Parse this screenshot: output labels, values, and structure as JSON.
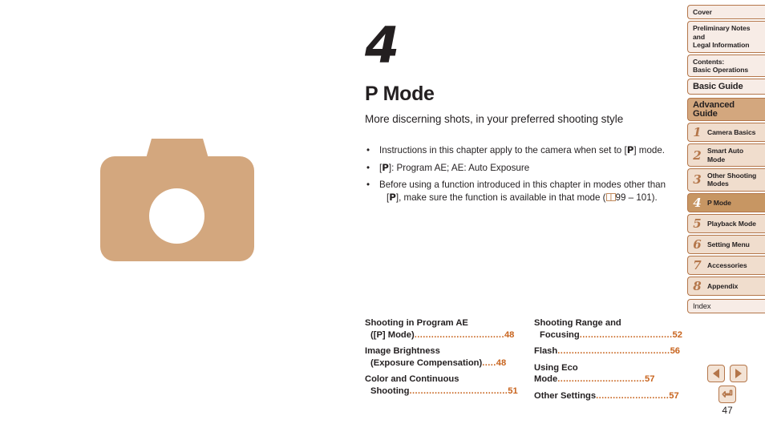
{
  "document": {
    "page_number": "47"
  },
  "illustration": {
    "name": "camera-illustration",
    "color": "#d3a77e"
  },
  "chapter": {
    "number": "4",
    "title": "P Mode",
    "subtitle": "More discerning shots, in your preferred shooting style"
  },
  "bullets": [
    {
      "line1_pre": "Instructions in this chapter apply to the camera when set to [",
      "mark": "P",
      "line1_post": "] mode.",
      "line2": ""
    },
    {
      "line1_pre": "[",
      "mark": "P",
      "line1_post": "]: Program AE; AE: Auto Exposure",
      "line2": ""
    },
    {
      "line1_pre": "Before using a function introduced in this chapter in modes other than",
      "mark": "P",
      "line1_post": "",
      "line2_pre": "[",
      "line2_post": "], make sure the function is available in that mode (",
      "line2_ref": "99 – 101)."
    }
  ],
  "toc": {
    "columns": [
      {
        "entries": [
          {
            "line1": "Shooting in Program AE",
            "line2": "([P] Mode)",
            "leader": "................................",
            "page": "48"
          },
          {
            "line1": "Image Brightness",
            "line2": "(Exposure Compensation)",
            "leader": ".....",
            "page": "48"
          },
          {
            "line1": "Color and Continuous",
            "line2": "Shooting",
            "leader": "...................................",
            "page": "51"
          }
        ]
      },
      {
        "entries": [
          {
            "line1": "Shooting Range and",
            "line2": "Focusing",
            "leader": ".................................",
            "page": "52"
          },
          {
            "line1": "",
            "line2": "Flash",
            "leader": "........................................",
            "page": "56"
          },
          {
            "line1": "",
            "line2": "Using Eco Mode",
            "leader": "...............................",
            "page": "57"
          },
          {
            "line1": "",
            "line2": "Other Settings",
            "leader": "..........................",
            "page": "57"
          }
        ]
      }
    ]
  },
  "sidebar": {
    "items": [
      {
        "type": "plain",
        "label": "Cover",
        "num": ""
      },
      {
        "type": "plain",
        "label": "Preliminary Notes and\nLegal Information",
        "num": ""
      },
      {
        "type": "plain",
        "label": "Contents:\nBasic Operations",
        "num": ""
      },
      {
        "type": "section",
        "label": "Basic Guide",
        "num": ""
      },
      {
        "type": "advanced",
        "label": "Advanced Guide",
        "num": ""
      },
      {
        "type": "chapter",
        "label": "Camera Basics",
        "num": "1"
      },
      {
        "type": "chapter",
        "label": "Smart Auto\nMode",
        "num": "2"
      },
      {
        "type": "chapter",
        "label": "Other Shooting\nModes",
        "num": "3"
      },
      {
        "type": "chapter",
        "label": "P Mode",
        "num": "4",
        "active": true
      },
      {
        "type": "chapter",
        "label": "Playback Mode",
        "num": "5"
      },
      {
        "type": "chapter",
        "label": "Setting Menu",
        "num": "6"
      },
      {
        "type": "chapter",
        "label": "Accessories",
        "num": "7"
      },
      {
        "type": "chapter",
        "label": "Appendix",
        "num": "8"
      },
      {
        "type": "index",
        "label": "Index",
        "num": ""
      }
    ]
  },
  "nav": {
    "previous_label": "◀",
    "next_label": "▶",
    "back_label": "↰",
    "accent": "#b4764a"
  }
}
